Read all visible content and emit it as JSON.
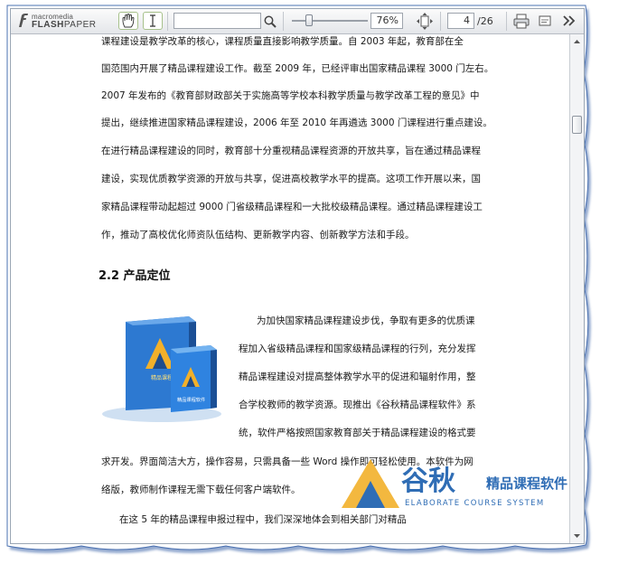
{
  "toolbar": {
    "logo_small": "macromedia",
    "logo_big_bold": "FLASH",
    "logo_big_light": "PAPER",
    "search_value": "",
    "zoom_value": "76%",
    "page_value": "4",
    "page_total": "/26",
    "icons": [
      "hand-tool-icon",
      "text-select-icon",
      "search-icon",
      "zoom-slider",
      "fit-page-icon",
      "print-icon",
      "options-icon",
      "more-icon"
    ]
  },
  "document": {
    "lines": [
      "课程建设是教学改革的核心，课程质量直接影响教学质量。自 2003 年起，教育部在全",
      "国范围内开展了精品课程建设工作。截至 2009 年，已经评审出国家精品课程 3000 门左右。",
      "2007 年发布的《教育部财政部关于实施高等学校本科教学质量与教学改革工程的意见》中",
      "提出，继续推进国家精品课程建设，2006 年至 2010 年再遴选 3000 门课程进行重点建设。",
      "在进行精品课程建设的同时，教育部十分重视精品课程资源的开放共享，旨在通过精品课程",
      "建设，实现优质教学资源的开放与共享，促进高校教学水平的提高。这项工作开展以来，国",
      "家精品课程带动起超过 9000 门省级精品课程和一大批校级精品课程。通过精品课程建设工",
      "作，推动了高校优化师资队伍结构、更新教学内容、创新教学方法和手段。"
    ],
    "heading": "2.2  产品定位",
    "wrap_lines": [
      "为加快国家精品课程建设步伐，争取有更多的优质课",
      "程加入省级精品课程和国家级精品课程的行列，充分发挥",
      "精品课程建设对提高整体教学水平的促进和辐射作用，整",
      "合学校教师的教学资源。现推出《谷秋精品课程软件》系",
      "统，软件严格按照国家教育部关于精品课程建设的格式要"
    ],
    "after_lines": [
      "求开发。界面简洁大方，操作容易，只需具备一些  Word  操作即可轻松使用。本软件为网",
      "络版，教师制作课程无需下载任何客户端软件。",
      "在这  5  年的精品课程申报过程中，我们深深地体会到相关部门对精品"
    ],
    "product_box_front": "精品课程软件",
    "product_box_back": "精品课程"
  },
  "watermark": {
    "brand_cn": "谷秋",
    "product_cn": "精品课程软件",
    "brand_en": "ELABORATE COURSE SYSTEM"
  },
  "colors": {
    "frame_blue": "#3a63a8",
    "toolbar_green": "#a7c18b",
    "watermark_blue": "#2f6db5",
    "watermark_yellow": "#f2b02a",
    "box_blue": "#2d79d1"
  }
}
